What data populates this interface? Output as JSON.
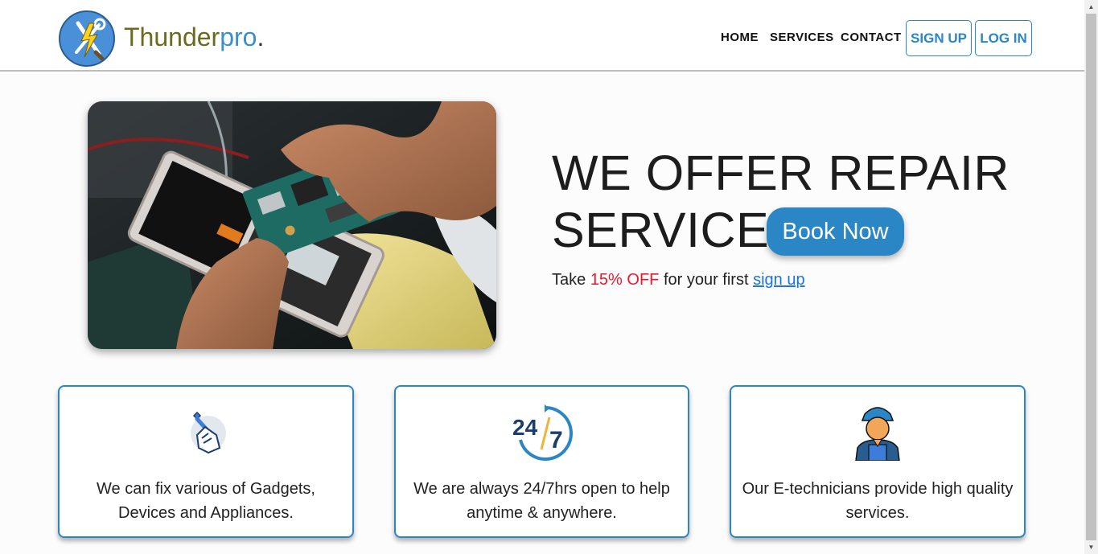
{
  "brand": {
    "name_part1": "Thunder",
    "name_part2": "pro",
    "name_dot": ".",
    "logo_icon": "lightning-tools-icon",
    "accent": "#2a86c4"
  },
  "nav": {
    "links": [
      "HOME",
      "SERVICES",
      "CONTACT"
    ],
    "signup_label": "SIGN UP",
    "login_label": "LOG IN"
  },
  "hero": {
    "image_alt": "hands repairing a smartphone circuit board",
    "headline_line1": "WE OFFER REPAIR",
    "headline_line2": "SERVICE",
    "book_label": "Book Now",
    "offer_prefix": "Take ",
    "offer_highlight": "15% OFF",
    "offer_middle": " for your first ",
    "offer_link": "sign up"
  },
  "features": [
    {
      "icon": "wrench-hand-icon",
      "text": "We can fix various of Gadgets, Devices and Appliances."
    },
    {
      "icon": "24-7-icon",
      "text": "We are always 24/7hrs open to help anytime & anywhere."
    },
    {
      "icon": "technician-icon",
      "text": "Our E-technicians provide high quality services."
    }
  ],
  "colors": {
    "offer_red": "#e8192c",
    "link_blue": "#1a73e8",
    "button_blue": "#2a86c4"
  }
}
